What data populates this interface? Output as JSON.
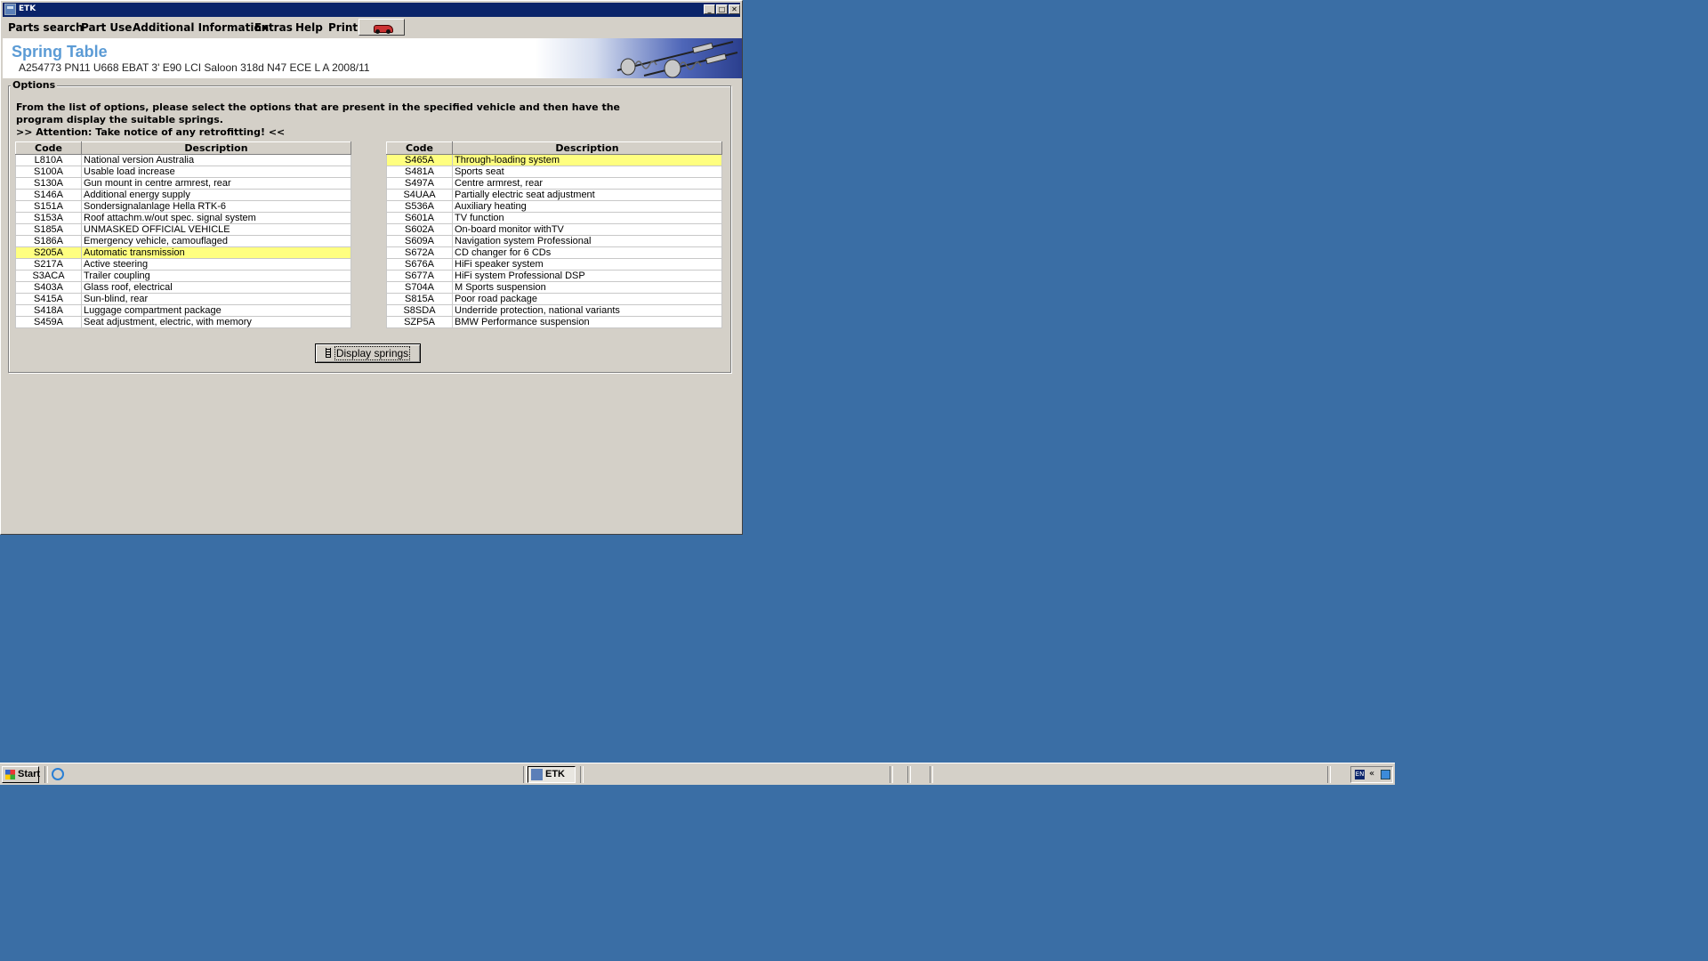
{
  "window": {
    "title": "ETK"
  },
  "menu": {
    "items": [
      "Parts search",
      "Part Use",
      "Additional Information",
      "Extras",
      "Help",
      "Print"
    ]
  },
  "header": {
    "title": "Spring Table",
    "subtitle": "A254773 PN11 U668 EBAT 3' E90 LCI Saloon 318d N47 ECE L A 2008/11"
  },
  "options": {
    "legend": "Options",
    "instruction_line1": "From the list of options, please select the options that are present in the specified vehicle and then have the",
    "instruction_line2": "program display the suitable springs.",
    "attention": ">> Attention: Take notice of any retrofitting! <<",
    "col_code": "Code",
    "col_description": "Description",
    "left_rows": [
      {
        "code": "L810A",
        "desc": "National version Australia",
        "selected": false
      },
      {
        "code": "S100A",
        "desc": "Usable load increase",
        "selected": false
      },
      {
        "code": "S130A",
        "desc": "Gun mount in centre armrest, rear",
        "selected": false
      },
      {
        "code": "S146A",
        "desc": "Additional energy supply",
        "selected": false
      },
      {
        "code": "S151A",
        "desc": "Sondersignalanlage Hella RTK-6",
        "selected": false
      },
      {
        "code": "S153A",
        "desc": "Roof attachm.w/out spec. signal system",
        "selected": false
      },
      {
        "code": "S185A",
        "desc": "UNMASKED OFFICIAL VEHICLE",
        "selected": false
      },
      {
        "code": "S186A",
        "desc": "Emergency vehicle, camouflaged",
        "selected": false
      },
      {
        "code": "S205A",
        "desc": "Automatic transmission",
        "selected": true
      },
      {
        "code": "S217A",
        "desc": "Active steering",
        "selected": false
      },
      {
        "code": "S3ACA",
        "desc": "Trailer coupling",
        "selected": false
      },
      {
        "code": "S403A",
        "desc": "Glass roof, electrical",
        "selected": false
      },
      {
        "code": "S415A",
        "desc": "Sun-blind, rear",
        "selected": false
      },
      {
        "code": "S418A",
        "desc": "Luggage compartment package",
        "selected": false
      },
      {
        "code": "S459A",
        "desc": "Seat adjustment, electric, with memory",
        "selected": false
      }
    ],
    "right_rows": [
      {
        "code": "S465A",
        "desc": "Through-loading system",
        "selected": true
      },
      {
        "code": "S481A",
        "desc": "Sports seat",
        "selected": false
      },
      {
        "code": "S497A",
        "desc": "Centre armrest, rear",
        "selected": false
      },
      {
        "code": "S4UAA",
        "desc": "Partially electric seat adjustment",
        "selected": false
      },
      {
        "code": "S536A",
        "desc": "Auxiliary heating",
        "selected": false
      },
      {
        "code": "S601A",
        "desc": "TV function",
        "selected": false
      },
      {
        "code": "S602A",
        "desc": "On-board monitor withTV",
        "selected": false
      },
      {
        "code": "S609A",
        "desc": "Navigation system Professional",
        "selected": false
      },
      {
        "code": "S672A",
        "desc": "CD changer for 6 CDs",
        "selected": false
      },
      {
        "code": "S676A",
        "desc": "HiFi speaker system",
        "selected": false
      },
      {
        "code": "S677A",
        "desc": "HiFi system Professional DSP",
        "selected": false
      },
      {
        "code": "S704A",
        "desc": "M Sports suspension",
        "selected": false
      },
      {
        "code": "S815A",
        "desc": "Poor road package",
        "selected": false
      },
      {
        "code": "S8SDA",
        "desc": "Underride protection, national variants",
        "selected": false
      },
      {
        "code": "SZP5A",
        "desc": "BMW Performance suspension",
        "selected": false
      }
    ],
    "display_button": "Display springs"
  },
  "taskbar": {
    "start_label": "Start",
    "task_label": "ETK",
    "tray_lang": "EN",
    "tray_chevron": "«"
  },
  "colors": {
    "desktop": "#3a6ea5",
    "title_bar": "#0a246a",
    "header_title": "#5b9bd5",
    "selected_row": "#ffff80"
  },
  "icons": [
    "etk-app-icon",
    "minimize-icon",
    "maximize-icon",
    "close-icon",
    "car-icon",
    "spring-icon",
    "windows-logo-icon",
    "ie-icon",
    "network-icon"
  ]
}
